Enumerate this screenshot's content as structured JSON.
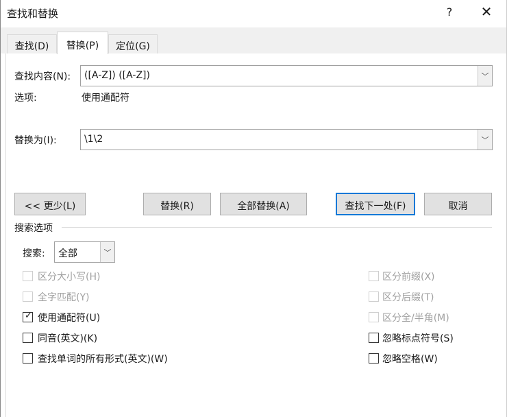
{
  "window": {
    "title": "查找和替换",
    "help": "?",
    "close": "✕"
  },
  "tabs": [
    {
      "label": "查找(D)",
      "selected": false
    },
    {
      "label": "替换(P)",
      "selected": true
    },
    {
      "label": "定位(G)",
      "selected": false
    }
  ],
  "find": {
    "label": "查找内容(N):",
    "value": "([A-Z]) ([A-Z])",
    "options_label": "选项:",
    "options_value": "使用通配符"
  },
  "replace": {
    "label": "替换为(I):",
    "value": "\\1\\2"
  },
  "buttons": {
    "less": "<< 更少(L)",
    "replace": "替换(R)",
    "replace_all": "全部替换(A)",
    "find_next": "查找下一处(F)",
    "cancel": "取消"
  },
  "search_options": {
    "title": "搜索选项",
    "search_label": "搜索:",
    "search_value": "全部"
  },
  "checkboxes_left": [
    {
      "label": "区分大小写(H)",
      "checked": false,
      "disabled": true
    },
    {
      "label": "全字匹配(Y)",
      "checked": false,
      "disabled": true
    },
    {
      "label": "使用通配符(U)",
      "checked": true,
      "disabled": false
    },
    {
      "label": "同音(英文)(K)",
      "checked": false,
      "disabled": false
    },
    {
      "label": "查找单词的所有形式(英文)(W)",
      "checked": false,
      "disabled": false
    }
  ],
  "checkboxes_right": [
    {
      "label": "区分前缀(X)",
      "checked": false,
      "disabled": true
    },
    {
      "label": "区分后缀(T)",
      "checked": false,
      "disabled": true
    },
    {
      "label": "区分全/半角(M)",
      "checked": false,
      "disabled": true
    },
    {
      "label": "忽略标点符号(S)",
      "checked": false,
      "disabled": false
    },
    {
      "label": "忽略空格(W)",
      "checked": false,
      "disabled": false
    }
  ],
  "colors": {
    "focus": "#0078d7",
    "button": "#e1e1e1"
  }
}
